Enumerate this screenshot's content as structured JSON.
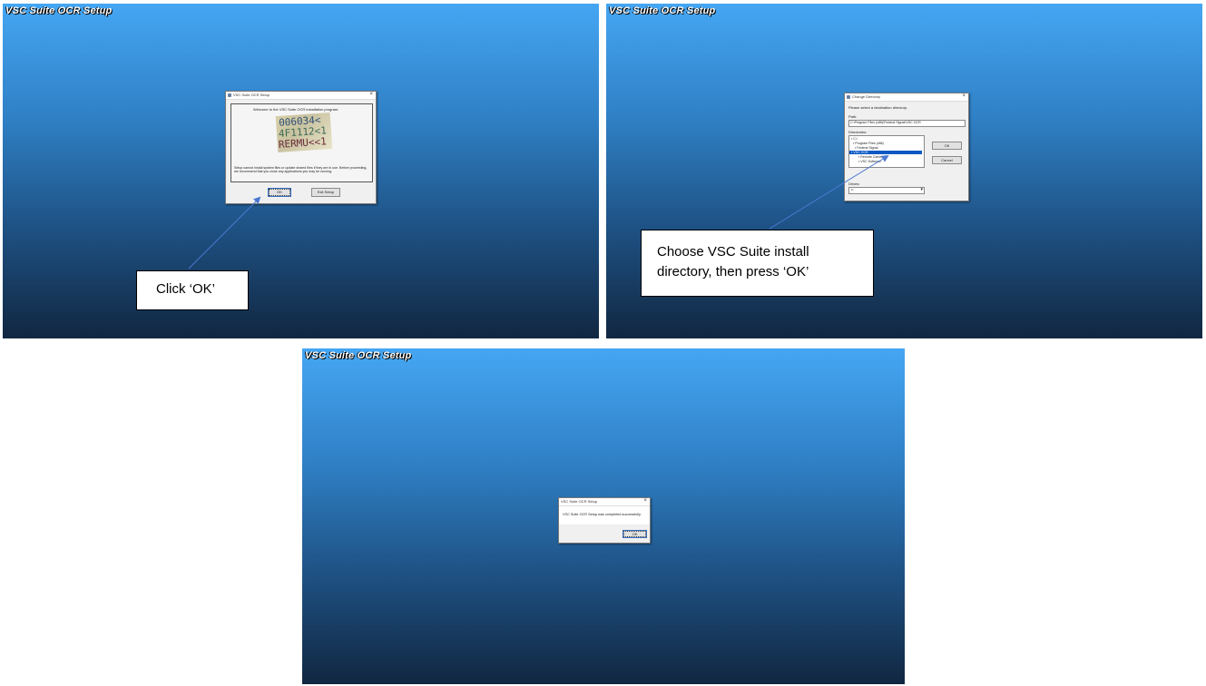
{
  "app_title": "VSC Suite OCR Setup",
  "step1": {
    "dialog_title": "VSC Suite OCR Setup",
    "welcome_text": "Welcome to the VSC Suite OCR installation program.",
    "image_line1": "006034<",
    "image_line2": "4F1112<1",
    "image_line3": "RERMU<<1",
    "warning_text": "Setup cannot install system files or update shared files if they are in use. Before proceeding, we recommend that you close any applications you may be running.",
    "ok_label": "OK",
    "exit_label": "Exit Setup",
    "callout": "Click ‘OK’"
  },
  "step2": {
    "dialog_title": "Change Directory",
    "instruction": "Please select a destination directory.",
    "path_label": "Path:",
    "path_value": "C:\\Program Files (x86)\\Federal Signal\\VSC OCR",
    "directories_label": "Directories:",
    "directories": [
      "C:\\",
      "Program Files (x86)",
      "Federal Signal",
      "VSC OCR",
      "Remote Camera",
      "VSC Software"
    ],
    "drives_label": "Drives:",
    "drive_value": "c:",
    "ok_label": "OK",
    "cancel_label": "Cancel",
    "callout_line1": "Choose VSC Suite install",
    "callout_line2": "directory, then press ‘OK’"
  },
  "step3": {
    "dialog_title": "VSC Suite OCR Setup",
    "message": "VSC Suite OCR Setup was completed successfully.",
    "ok_label": "OK"
  },
  "colors": {
    "gradient_top": "#45a6f3",
    "gradient_bottom": "#112741",
    "arrow": "#4a78d0"
  }
}
